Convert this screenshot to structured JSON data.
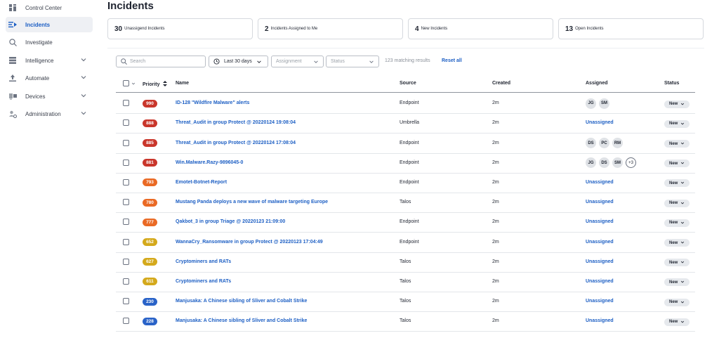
{
  "sidebar": {
    "items": [
      {
        "label": "Control Center",
        "icon": "dashboard-icon",
        "expandable": false,
        "active": false
      },
      {
        "label": "Incidents",
        "icon": "incidents-icon",
        "expandable": false,
        "active": true
      },
      {
        "label": "Investigate",
        "icon": "search-icon",
        "expandable": false,
        "active": false
      },
      {
        "label": "Intelligence",
        "icon": "intelligence-icon",
        "expandable": true,
        "active": false
      },
      {
        "label": "Automate",
        "icon": "automate-icon",
        "expandable": true,
        "active": false
      },
      {
        "label": "Devices",
        "icon": "devices-icon",
        "expandable": true,
        "active": false
      },
      {
        "label": "Administration",
        "icon": "admin-icon",
        "expandable": true,
        "active": false
      }
    ]
  },
  "page": {
    "title": "Incidents"
  },
  "summary_cards": [
    {
      "count": "30",
      "label": "Unassigend Incidents"
    },
    {
      "count": "2",
      "label": "Incidents Assigned to Me"
    },
    {
      "count": "4",
      "label": "New Incidents"
    },
    {
      "count": "13",
      "label": "Open Incidents"
    }
  ],
  "filters": {
    "search_placeholder": "Search",
    "date_range": "Last 30 days",
    "assignment": "Assignment",
    "status": "Status",
    "results": "123 matching results",
    "reset": "Reset all"
  },
  "table": {
    "columns": {
      "priority": "Priority",
      "name": "Name",
      "source": "Source",
      "created": "Created",
      "assigned": "Assigned",
      "status": "Status"
    },
    "rows": [
      {
        "priority": "990",
        "color": "#c9362b",
        "name": "ID-128 \"Wildfire Malware\" alerts",
        "source": "Endpoint",
        "created": "2m",
        "assigned": [
          "JG",
          "SM"
        ],
        "more": "",
        "status": "New"
      },
      {
        "priority": "888",
        "color": "#c9362b",
        "name": "Threat_Audit in group Protect @ 20220124 19:08:04",
        "source": "Umbrella",
        "created": "2m",
        "assigned": [],
        "unassigned": "Unassigned",
        "more": "",
        "status": "New"
      },
      {
        "priority": "885",
        "color": "#c9362b",
        "name": "Threat_Audit in group Protect @ 20220124 17:08:04",
        "source": "Endpoint",
        "created": "2m",
        "assigned": [
          "DS",
          "PC",
          "RM"
        ],
        "more": "",
        "status": "New"
      },
      {
        "priority": "881",
        "color": "#c9362b",
        "name": "Win.Malware.Razy-9896045-0",
        "source": "Endpoint",
        "created": "2m",
        "assigned": [
          "JG",
          "DS",
          "SM"
        ],
        "more": "+3",
        "status": "New"
      },
      {
        "priority": "793",
        "color": "#ea6a25",
        "name": "Emotet-Botnet-Report",
        "source": "Endpoint",
        "created": "2m",
        "assigned": [],
        "unassigned": "Unassigned",
        "more": "",
        "status": "New"
      },
      {
        "priority": "780",
        "color": "#ea6a25",
        "name": "Mustang Panda deploys a new wave of malware targeting Europe",
        "source": "Talos",
        "created": "2m",
        "assigned": [],
        "unassigned": "Unassigned",
        "more": "",
        "status": "New"
      },
      {
        "priority": "777",
        "color": "#ea6a25",
        "name": "Qakbot_3 in group Triage @ 20220123 21:09:00",
        "source": "Endpoint",
        "created": "2m",
        "assigned": [],
        "unassigned": "Unassigned",
        "more": "",
        "status": "New"
      },
      {
        "priority": "652",
        "color": "#d4a91c",
        "name": "WannaCry_Ransomware in group Protect @ 20220123 17:04:49",
        "source": "Endpoint",
        "created": "2m",
        "assigned": [],
        "unassigned": "Unassigned",
        "more": "",
        "status": "New"
      },
      {
        "priority": "627",
        "color": "#d4a91c",
        "name": "Cryptominers and RATs",
        "source": "Talos",
        "created": "2m",
        "assigned": [],
        "unassigned": "Unassigned",
        "more": "",
        "status": "New"
      },
      {
        "priority": "611",
        "color": "#d4a91c",
        "name": "Cryptominers and RATs",
        "source": "Talos",
        "created": "2m",
        "assigned": [],
        "unassigned": "Unassigned",
        "more": "",
        "status": "New"
      },
      {
        "priority": "230",
        "color": "#2a63c8",
        "name": "Manjusaka: A Chinese sibling of Sliver and Cobalt Strike",
        "source": "Talos",
        "created": "2m",
        "assigned": [],
        "unassigned": "Unassigned",
        "more": "",
        "status": "New"
      },
      {
        "priority": "228",
        "color": "#2a63c8",
        "name": "Manjusaka: A Chinese sibling of Sliver and Cobalt Strike",
        "source": "Talos",
        "created": "2m",
        "assigned": [],
        "unassigned": "Unassigned",
        "more": "",
        "status": "New"
      }
    ]
  }
}
